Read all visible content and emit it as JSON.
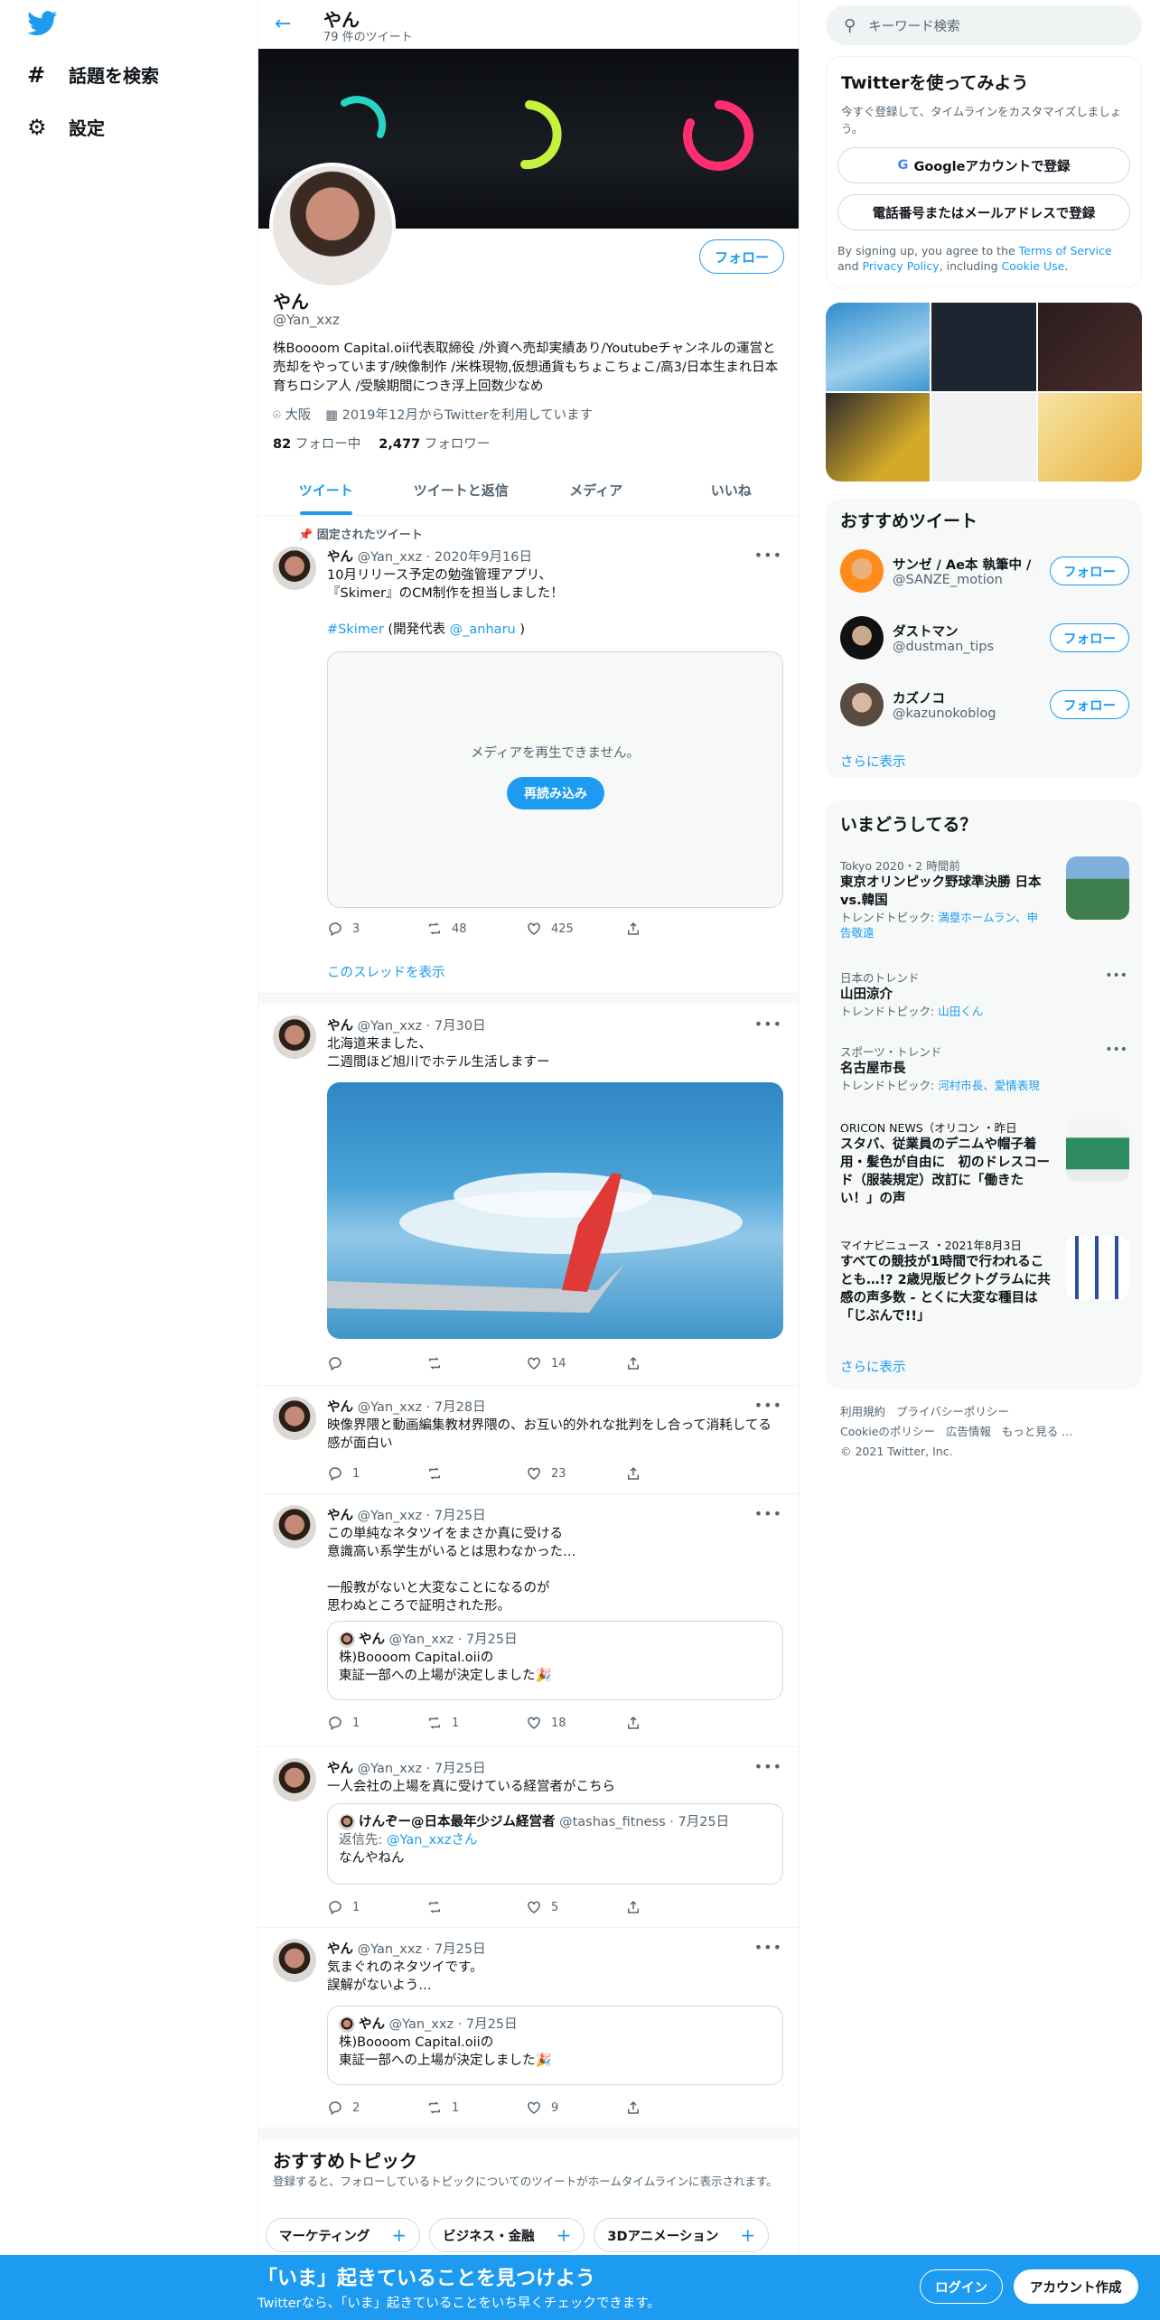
{
  "nav": {
    "items": [
      {
        "icon": "hashtag-icon",
        "label": "話題を検索"
      },
      {
        "icon": "gear-icon",
        "label": "設定"
      }
    ]
  },
  "header": {
    "name": "やん",
    "tweet_count": "79 件のツイート"
  },
  "profile": {
    "name": "やん",
    "handle": "@Yan_xxz",
    "follow_label": "フォロー",
    "bio": "株Boooom Capital.oii代表取締役 /外資へ売却実績あり/Youtubeチャンネルの運営と売却をやっています/映像制作 /米株現物,仮想通貨もちょこちょこ/高3/日本生まれ日本育ちロシア人 /受験期間につき浮上回数少なめ",
    "location": "大阪",
    "joined": "2019年12月からTwitterを利用しています",
    "following_count": "82",
    "following_label": "フォロー中",
    "followers_count": "2,477",
    "followers_label": "フォロワー"
  },
  "tabs": [
    "ツイート",
    "ツイートと返信",
    "メディア",
    "いいね"
  ],
  "pinned_label": "固定されたツイート",
  "tweets": [
    {
      "name": "やん",
      "handle": "@Yan_xxz",
      "date": "2020年9月16日",
      "text": "10月リリース予定の勉強管理アプリ、\n『Skimer』のCM制作を担当しました！",
      "hashtag": "#Skimer",
      "text2_pre": " (開発代表 ",
      "mention": "@_anharu",
      "text2_post": " )",
      "media_error": "メディアを再生できません。",
      "reload_label": "再読み込み",
      "replies": "3",
      "retweets": "48",
      "likes": "425",
      "thread_link": "このスレッドを表示"
    },
    {
      "name": "やん",
      "handle": "@Yan_xxz",
      "date": "7月30日",
      "text": "北海道来ました、\n二週間ほど旭川でホテル生活しますー",
      "replies": "",
      "retweets": "",
      "likes": "14"
    },
    {
      "name": "やん",
      "handle": "@Yan_xxz",
      "date": "7月28日",
      "text": "映像界隈と動画編集教材界隈の、お互い的外れな批判をし合って消耗してる感が面白い",
      "replies": "1",
      "retweets": "",
      "likes": "23"
    },
    {
      "name": "やん",
      "handle": "@Yan_xxz",
      "date": "7月25日",
      "text": "この単純なネタツイをまさか真に受ける\n意識高い系学生がいるとは思わなかった…\n\n一般教がないと大変なことになるのが\n思わぬところで証明された形。",
      "quote": {
        "name": "やん",
        "handle": "@Yan_xxz",
        "date": "7月25日",
        "text": "株)Boooom Capital.oiiの\n東証一部への上場が決定しました🎉"
      },
      "replies": "1",
      "retweets": "1",
      "likes": "18"
    },
    {
      "name": "やん",
      "handle": "@Yan_xxz",
      "date": "7月25日",
      "text": "一人会社の上場を真に受けている経営者がこちら",
      "quote": {
        "name": "けんぞー@日本最年少ジム経営者",
        "handle": "@tashas_fitness",
        "date": "7月25日",
        "reply_to_label": "返信先: ",
        "reply_to": "@Yan_xxzさん",
        "text": "なんやねん"
      },
      "replies": "1",
      "retweets": "",
      "likes": "5"
    },
    {
      "name": "やん",
      "handle": "@Yan_xxz",
      "date": "7月25日",
      "text": "気まぐれのネタツイです。\n誤解がないよう…",
      "quote": {
        "name": "やん",
        "handle": "@Yan_xxz",
        "date": "7月25日",
        "text": "株)Boooom Capital.oiiの\n東証一部への上場が決定しました🎉"
      },
      "replies": "2",
      "retweets": "1",
      "likes": "9"
    }
  ],
  "topics": {
    "title": "おすすめトピック",
    "subtitle": "登録すると、フォローしているトピックについてのツイートがホームタイムラインに表示されます。",
    "chips": [
      "マーケティング",
      "ビジネス・金融",
      "3Dアニメーション"
    ]
  },
  "search": {
    "placeholder": "キーワード検索"
  },
  "signup_card": {
    "title": "Twitterを使ってみよう",
    "subtitle": "今すぐ登録して、タイムラインをカスタマイズしましょう。",
    "google_label": "Googleアカウントで登録",
    "phone_label": "電話番号またはメールアドレスで登録",
    "legal_pre": "By signing up, you agree to the ",
    "tos": "Terms of Service",
    "legal_mid": " and ",
    "privacy": "Privacy Policy",
    "legal_mid2": ", including ",
    "cookie": "Cookie Use",
    "legal_end": "."
  },
  "recommended": {
    "title": "おすすめツイート",
    "follow_label": "フォロー",
    "show_more": "さらに表示",
    "users": [
      {
        "name": "サンゼ / Ae本 執筆中 / ...",
        "handle": "@SANZE_motion"
      },
      {
        "name": "ダストマン",
        "handle": "@dustman_tips"
      },
      {
        "name": "カズノコ",
        "handle": "@kazunokoblog"
      }
    ]
  },
  "trends": {
    "title": "いまどうしてる？",
    "show_more": "さらに表示",
    "items": [
      {
        "context": "Tokyo 2020・2 時間前",
        "title": "東京オリンピック野球準決勝 日本 vs.韓国",
        "sub_pre": "トレンドトピック: ",
        "sub_link": "満塁ホームラン、申告敬遠"
      },
      {
        "context": "日本のトレンド",
        "title": "山田涼介",
        "sub_pre": "トレンドトピック: ",
        "sub_link": "山田くん"
      },
      {
        "context": "スポーツ・トレンド",
        "title": "名古屋市長",
        "sub_pre": "トレンドトピック: ",
        "sub_link": "河村市長、愛情表現"
      },
      {
        "context": "ORICON NEWS（オリコン ・昨日",
        "title": "スタバ、従業員のデニムや帽子着用・髪色が自由に　初のドレスコード（服装規定）改訂に「働きたい！」の声"
      },
      {
        "context": "マイナビニュース ・2021年8月3日",
        "title": "すべての競技が1時間で行われることも…!? 2歳児版ピクトグラムに共感の声多数 - とくに大変な種目は「じぶんで!!」"
      }
    ]
  },
  "footer": {
    "links": [
      "利用規約",
      "プライバシーポリシー",
      "Cookieのポリシー",
      "広告情報",
      "もっと見る ..."
    ],
    "copyright": "© 2021 Twitter, Inc."
  },
  "bottom_banner": {
    "title": "「いま」起きていることを見つけよう",
    "subtitle": "Twitterなら、「いま」起きていることをいち早くチェックできます。",
    "login_label": "ログイン",
    "signup_label": "アカウント作成"
  },
  "colors": {
    "accent": "#1d9bf0",
    "banner_bg": "#1d9bf0",
    "text": "#0f1419",
    "muted": "#536471"
  }
}
